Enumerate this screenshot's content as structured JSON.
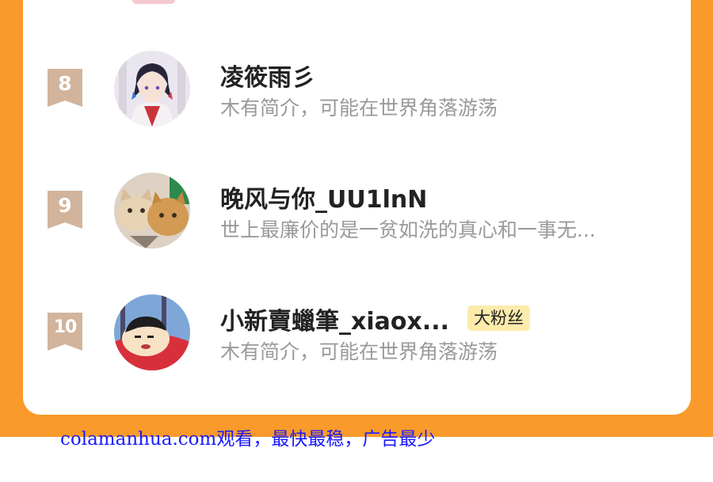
{
  "colors": {
    "background": "#f99a2b",
    "card": "#ffffff",
    "rank_badge": "#d2b49c",
    "name": "#222222",
    "bio": "#9a9a9a",
    "fan_badge_bg": "#fcebaa",
    "watermark": "#1a1aff"
  },
  "ranking": [
    {
      "rank": "8",
      "name": "凌筱雨彡",
      "bio": "木有简介，可能在世界角落游荡",
      "avatar": "anime-boy-avatar",
      "badge": ""
    },
    {
      "rank": "9",
      "name": "晚风与你_UU1lnN",
      "bio": "世上最廉价的是一贫如洗的真心和一事无...",
      "avatar": "cats-avatar",
      "badge": ""
    },
    {
      "rank": "10",
      "name": "小新賣蠟筆_xiaox...",
      "bio": "木有简介，可能在世界角落游荡",
      "avatar": "crayon-shinchan-avatar",
      "badge": "大粉丝"
    }
  ],
  "watermark": "colamanhua.com观看，最快最稳，广告最少"
}
